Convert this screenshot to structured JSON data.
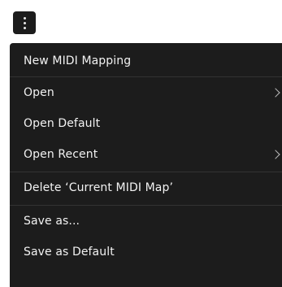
{
  "toolbar": {
    "more_button_icon": "kebab-vertical-icon"
  },
  "menu": {
    "items": [
      {
        "label": "New MIDI Mapping",
        "has_submenu": false
      },
      {
        "label": "Open",
        "has_submenu": true
      },
      {
        "label": "Open Default",
        "has_submenu": false
      },
      {
        "label": "Open Recent",
        "has_submenu": true
      },
      {
        "label": "Delete ‘Current MIDI Map’",
        "has_submenu": false
      },
      {
        "label": "Save as...",
        "has_submenu": false
      },
      {
        "label": "Save as Default",
        "has_submenu": false
      }
    ]
  },
  "colors": {
    "menu_background": "#1c1c1c",
    "text": "#f2f2f2",
    "divider": "#333333"
  }
}
